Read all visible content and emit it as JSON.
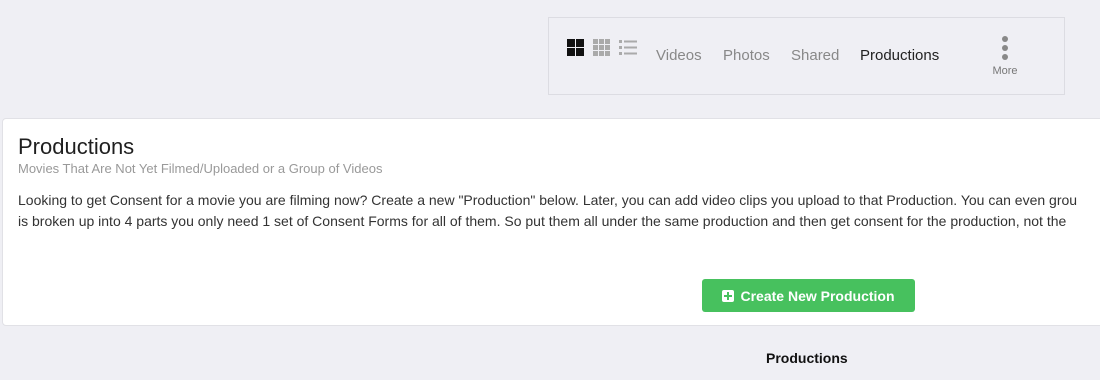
{
  "toolbar": {
    "view_icons": [
      "large-grid-icon",
      "small-grid-icon",
      "list-icon"
    ],
    "nav": [
      {
        "label": "Videos",
        "active": false
      },
      {
        "label": "Photos",
        "active": false
      },
      {
        "label": "Shared",
        "active": false
      },
      {
        "label": "Productions",
        "active": true
      }
    ],
    "more_label": "More"
  },
  "card": {
    "title": "Productions",
    "subtitle": "Movies That Are Not Yet Filmed/Uploaded or a Group of Videos",
    "description_lines": [
      "Looking to get Consent for a movie you are filming now? Create a new \"Production\" below. Later, you can add video clips you upload to that Production. You can even grou",
      "is broken up into 4 parts you only need 1 set of Consent Forms for all of them. So put them all under the same production and then get consent for the production, not the"
    ],
    "create_button_label": "Create New Production"
  },
  "section_heading": "Productions",
  "colors": {
    "background": "#efeff4",
    "card": "#ffffff",
    "button": "#47c15e",
    "active_nav": "#222222",
    "inactive_nav": "#888888"
  }
}
